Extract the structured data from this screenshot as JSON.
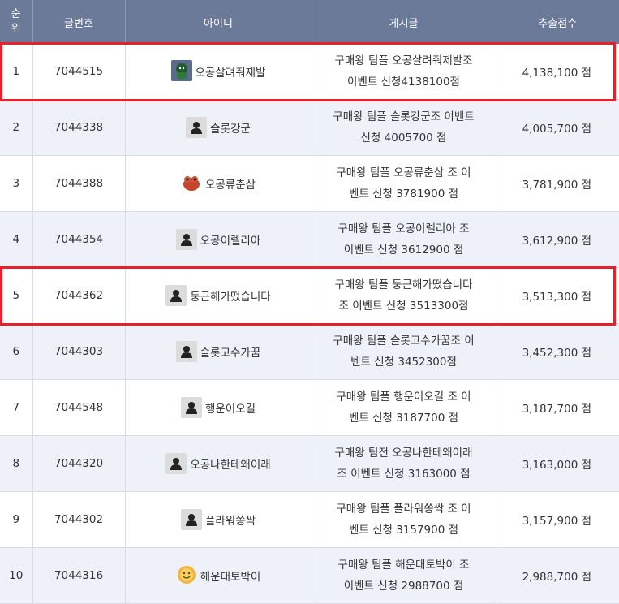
{
  "header": {
    "rank": "순위",
    "rank_l1": "순",
    "rank_l2": "위",
    "post_no": "글번호",
    "user_id": "아이디",
    "post": "게시글",
    "score": "추출점수"
  },
  "rows": [
    {
      "rank": "1",
      "post_no": "7044515",
      "user_id": "오공살려줘제발",
      "avatar": "green-character-avatar-icon",
      "post_l1": "구매왕 팀플 오공살려줘제발조",
      "post_l2": "이벤트 신청4138100점",
      "score": "4,138,100 점",
      "highlighted": true
    },
    {
      "rank": "2",
      "post_no": "7044338",
      "user_id": "슬롯강군",
      "avatar": "default-user-icon",
      "post_l1": "구매왕 팀플 슬롯강군조 이벤트",
      "post_l2": "신청 4005700 점",
      "score": "4,005,700 점",
      "highlighted": false
    },
    {
      "rank": "3",
      "post_no": "7044388",
      "user_id": "오공류춘삼",
      "avatar": "red-frog-avatar-icon",
      "post_l1": "구매왕 팀플 오공류춘삼 조 이",
      "post_l2": "벤트 신청 3781900 점",
      "score": "3,781,900 점",
      "highlighted": false
    },
    {
      "rank": "4",
      "post_no": "7044354",
      "user_id": "오공이렐리아",
      "avatar": "default-user-icon",
      "post_l1": "구매왕 팀플 오공이렐리아 조",
      "post_l2": "이벤트 신청 3612900 점",
      "score": "3,612,900 점",
      "highlighted": false
    },
    {
      "rank": "5",
      "post_no": "7044362",
      "user_id": "둥근해가떴습니다",
      "avatar": "default-user-icon",
      "post_l1": "구매왕 팀플 둥근해가떴습니다",
      "post_l2": "조 이벤트 신청 3513300점",
      "score": "3,513,300 점",
      "highlighted": true
    },
    {
      "rank": "6",
      "post_no": "7044303",
      "user_id": "슬롯고수가꿈",
      "avatar": "default-user-icon",
      "post_l1": "구매왕 팀플 슬롯고수가꿈조 이",
      "post_l2": "벤트 신청 3452300점",
      "score": "3,452,300 점",
      "highlighted": false
    },
    {
      "rank": "7",
      "post_no": "7044548",
      "user_id": "행운이오길",
      "avatar": "default-user-icon",
      "post_l1": "구매왕 팀플 행운이오길 조 이",
      "post_l2": "벤트 신청 3187700 점",
      "score": "3,187,700 점",
      "highlighted": false
    },
    {
      "rank": "8",
      "post_no": "7044320",
      "user_id": "오공나한테왜이래",
      "avatar": "default-user-icon",
      "post_l1": "구매왕 팀전 오공나한테왜이래",
      "post_l2": "조 이벤트 신청 3163000 점",
      "score": "3,163,000 점",
      "highlighted": false
    },
    {
      "rank": "9",
      "post_no": "7044302",
      "user_id": "플라워쏭싹",
      "avatar": "default-user-icon",
      "post_l1": "구매왕 팀플 플라워쏭싹 조 이",
      "post_l2": "벤트 신청 3157900 점",
      "score": "3,157,900 점",
      "highlighted": false
    },
    {
      "rank": "10",
      "post_no": "7044316",
      "user_id": "해운대토박이",
      "avatar": "orange-emoji-avatar-icon",
      "post_l1": "구매왕 팀플 해운대토박이 조",
      "post_l2": "이벤트 신청 2988700 점",
      "score": "2,988,700 점",
      "highlighted": false
    }
  ],
  "colors": {
    "header_bg": "#6b7a99",
    "row_alt_bg": "#eef1f7",
    "highlight_border": "#e8202a"
  }
}
